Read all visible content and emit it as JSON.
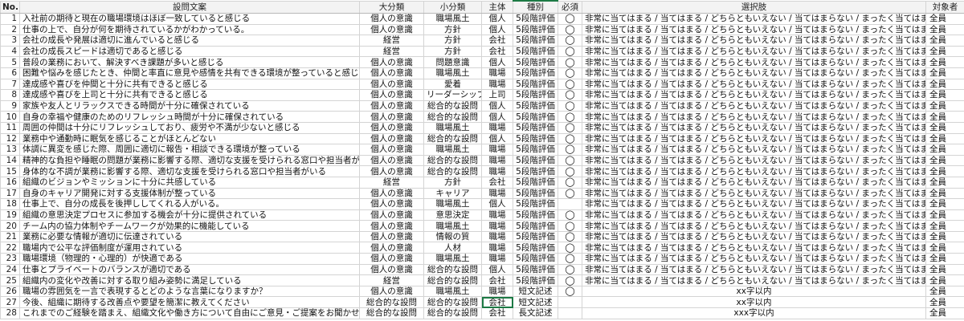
{
  "headers": {
    "no": "No.",
    "question": "設問文案",
    "major": "大分類",
    "minor": "小分類",
    "subject": "主体",
    "type": "種別",
    "required": "必須",
    "choices": "選択肢",
    "target": "対象者"
  },
  "rows": [
    {
      "no": "1",
      "question": "入社前の期待と現在の職場環境はほぼ一致していると感じる",
      "major": "個人の意識",
      "minor": "職場風土",
      "subject": "個人",
      "type": "5段階評価",
      "required": "◯",
      "choices": "非常に当てはまる / 当てはまる / どちらともいえない / 当てはまらない / まったく当てはまらない",
      "target": "全員"
    },
    {
      "no": "2",
      "question": "仕事の上で、自分が何を期待されているかがわかっている。",
      "major": "個人の意識",
      "minor": "方針",
      "subject": "個人",
      "type": "5段階評価",
      "required": "◯",
      "choices": "非常に当てはまる / 当てはまる / どちらともいえない / 当てはまらない / まったく当てはまらない",
      "target": "全員"
    },
    {
      "no": "3",
      "question": "会社の成長や発展は適切に進んでいると感じる",
      "major": "経営",
      "minor": "方針",
      "subject": "会社",
      "type": "5段階評価",
      "required": "◯",
      "choices": "非常に当てはまる / 当てはまる / どちらともいえない / 当てはまらない / まったく当てはまらない",
      "target": "全員"
    },
    {
      "no": "4",
      "question": "会社の成長スピードは適切であると感じる",
      "major": "経営",
      "minor": "方針",
      "subject": "会社",
      "type": "5段階評価",
      "required": "◯",
      "choices": "非常に当てはまる / 当てはまる / どちらともいえない / 当てはまらない / まったく当てはまらない",
      "target": "全員"
    },
    {
      "no": "5",
      "question": "普段の業務において、解決すべき課題が多いと感じる",
      "major": "個人の意識",
      "minor": "問題意識",
      "subject": "個人",
      "type": "5段階評価",
      "required": "◯",
      "choices": "非常に当てはまる / 当てはまる / どちらともいえない / 当てはまらない / まったく当てはまらない",
      "target": "全員"
    },
    {
      "no": "6",
      "question": "困難や悩みを感じたとき、仲間と率直に意見や感情を共有できる環境が整っていると感じる",
      "major": "個人の意識",
      "minor": "職場風土",
      "subject": "職場",
      "type": "5段階評価",
      "required": "◯",
      "choices": "非常に当てはまる / 当てはまる / どちらともいえない / 当てはまらない / まったく当てはまらない",
      "target": "全員"
    },
    {
      "no": "7",
      "question": "達成感や喜びを仲間と十分に共有できると感じる",
      "major": "個人の意識",
      "minor": "愛着",
      "subject": "職場",
      "type": "5段階評価",
      "required": "◯",
      "choices": "非常に当てはまる / 当てはまる / どちらともいえない / 当てはまらない / まったく当てはまらない",
      "target": "全員"
    },
    {
      "no": "8",
      "question": "達成感や喜びを上司と十分に共有できると感じる",
      "major": "個人の意識",
      "minor": "リーダーシップ",
      "subject": "上司",
      "type": "5段階評価",
      "required": "◯",
      "choices": "非常に当てはまる / 当てはまる / どちらともいえない / 当てはまらない / まったく当てはまらない",
      "target": "全員"
    },
    {
      "no": "9",
      "question": "家族や友人とリラックスできる時間が十分に確保されている",
      "major": "個人の意識",
      "minor": "総合的な設問",
      "subject": "個人",
      "type": "5段階評価",
      "required": "◯",
      "choices": "非常に当てはまる / 当てはまる / どちらともいえない / 当てはまらない / まったく当てはまらない",
      "target": "全員"
    },
    {
      "no": "10",
      "question": "自身の幸福や健康のためのリフレッシュ時間が十分に確保されている",
      "major": "個人の意識",
      "minor": "総合的な設問",
      "subject": "個人",
      "type": "5段階評価",
      "required": "◯",
      "choices": "非常に当てはまる / 当てはまる / どちらともいえない / 当てはまらない / まったく当てはまらない",
      "target": "全員"
    },
    {
      "no": "11",
      "question": "周囲の仲間は十分にリフレッシュしており、疲労や不満が少ないと感じる",
      "major": "個人の意識",
      "minor": "職場風土",
      "subject": "職場",
      "type": "5段階評価",
      "required": "◯",
      "choices": "非常に当てはまる / 当てはまる / どちらともいえない / 当てはまらない / まったく当てはまらない",
      "target": "全員"
    },
    {
      "no": "12",
      "question": "業務中や通勤時に眠気を感じることがほとんどない",
      "major": "個人の意識",
      "minor": "総合的な設問",
      "subject": "個人",
      "type": "5段階評価",
      "required": "◯",
      "choices": "非常に当てはまる / 当てはまる / どちらともいえない / 当てはまらない / まったく当てはまらない",
      "target": "全員"
    },
    {
      "no": "13",
      "question": "体調に異変を感じた際、周囲に適切に報告・相談できる環境が整っている",
      "major": "個人の意識",
      "minor": "職場風土",
      "subject": "職場",
      "type": "5段階評価",
      "required": "◯",
      "choices": "非常に当てはまる / 当てはまる / どちらともいえない / 当てはまらない / まったく当てはまらない",
      "target": "全員"
    },
    {
      "no": "14",
      "question": "精神的な負担や睡眠の問題が業務に影響する際、適切な支援を受けられる窓口や担当者がいる",
      "major": "個人の意識",
      "minor": "総合的な設問",
      "subject": "職場",
      "type": "5段階評価",
      "required": "◯",
      "choices": "非常に当てはまる / 当てはまる / どちらともいえない / 当てはまらない / まったく当てはまらない",
      "target": "全員"
    },
    {
      "no": "15",
      "question": "身体的な不調が業務に影響する際、適切な支援を受けられる窓口や担当者がいる",
      "major": "個人の意識",
      "minor": "総合的な設問",
      "subject": "職場",
      "type": "5段階評価",
      "required": "◯",
      "choices": "非常に当てはまる / 当てはまる / どちらともいえない / 当てはまらない / まったく当てはまらない",
      "target": "全員"
    },
    {
      "no": "16",
      "question": "組織のビジョンやミッションに十分に共感している",
      "major": "経営",
      "minor": "方針",
      "subject": "会社",
      "type": "5段階評価",
      "required": "◯",
      "choices": "非常に当てはまる / 当てはまる / どちらともいえない / 当てはまらない / まったく当てはまらない",
      "target": "全員"
    },
    {
      "no": "17",
      "question": "自身のキャリア開発に対する支援体制が整っている",
      "major": "個人の意識",
      "minor": "キャリア",
      "subject": "職場",
      "type": "5段階評価",
      "required": "◯",
      "choices": "非常に当てはまる / 当てはまる / どちらともいえない / 当てはまらない / まったく当てはまらない",
      "target": "全員"
    },
    {
      "no": "18",
      "question": "仕事上で、自分の成長を後押ししてくれる人がいる。",
      "major": "個人の意識",
      "minor": "職場風土",
      "subject": "個人",
      "type": "5段階評価",
      "required": "",
      "choices": "非常に当てはまる / 当てはまる / どちらともいえない / 当てはまらない / まったく当てはまらない",
      "target": "全員"
    },
    {
      "no": "19",
      "question": "組織の意思決定プロセスに参加する機会が十分に提供されている",
      "major": "個人の意識",
      "minor": "意思決定",
      "subject": "職場",
      "type": "5段階評価",
      "required": "◯",
      "choices": "非常に当てはまる / 当てはまる / どちらともいえない / 当てはまらない / まったく当てはまらない",
      "target": "全員"
    },
    {
      "no": "20",
      "question": "チーム内の協力体制やチームワークが効果的に機能している",
      "major": "個人の意識",
      "minor": "職場風土",
      "subject": "職場",
      "type": "5段階評価",
      "required": "◯",
      "choices": "非常に当てはまる / 当てはまる / どちらともいえない / 当てはまらない / まったく当てはまらない",
      "target": "全員"
    },
    {
      "no": "21",
      "question": "業務に必要な情報が適切に伝達されている",
      "major": "個人の意識",
      "minor": "情報の質",
      "subject": "職場",
      "type": "5段階評価",
      "required": "◯",
      "choices": "非常に当てはまる / 当てはまる / どちらともいえない / 当てはまらない / まったく当てはまらない",
      "target": "全員"
    },
    {
      "no": "22",
      "question": "職場内で公平な評価制度が運用されている",
      "major": "個人の意識",
      "minor": "人材",
      "subject": "職場",
      "type": "5段階評価",
      "required": "◯",
      "choices": "非常に当てはまる / 当てはまる / どちらともいえない / 当てはまらない / まったく当てはまらない",
      "target": "全員"
    },
    {
      "no": "23",
      "question": "職場環境（物理的・心理的）が快適である",
      "major": "個人の意識",
      "minor": "職場風土",
      "subject": "職場",
      "type": "5段階評価",
      "required": "◯",
      "choices": "非常に当てはまる / 当てはまる / どちらともいえない / 当てはまらない / まったく当てはまらない",
      "target": "全員"
    },
    {
      "no": "24",
      "question": "仕事とプライベートのバランスが適切である",
      "major": "個人の意識",
      "minor": "総合的な設問",
      "subject": "個人",
      "type": "5段階評価",
      "required": "◯",
      "choices": "非常に当てはまる / 当てはまる / どちらともいえない / 当てはまらない / まったく当てはまらない",
      "target": "全員"
    },
    {
      "no": "25",
      "question": "組織内の変化や改善に対する取り組み姿勢に満足している",
      "major": "経営",
      "minor": "総合的な設問",
      "subject": "会社",
      "type": "5段階評価",
      "required": "◯",
      "choices": "非常に当てはまる / 当てはまる / どちらともいえない / 当てはまらない / まったく当てはまらない",
      "target": "全員"
    },
    {
      "no": "26",
      "question": "職場の雰囲気を一言で表現するとどのような言葉になりますか？",
      "major": "個人の意識",
      "minor": "職場風土",
      "subject": "職場",
      "type": "短文記述",
      "required": "◯",
      "choices": "xx字以内",
      "target": "全員"
    },
    {
      "no": "27",
      "question": "今後、組織に期待する改善点や要望を簡潔に教えてください",
      "major": "総合的な設問",
      "minor": "総合的な設問",
      "subject": "会社",
      "type": "短文記述",
      "required": "",
      "choices": "xx字以内",
      "target": "全員"
    },
    {
      "no": "28",
      "question": "これまでのご経験を踏まえ、組織文化や働き方について自由にご意見・ご提案をお聞かせください",
      "major": "総合的な設問",
      "minor": "総合的な設問",
      "subject": "会社",
      "type": "長文記述",
      "required": "",
      "choices": "xxx字以内",
      "target": "全員"
    }
  ],
  "colors": {
    "selection_border": "#1d7a45",
    "header_bg": "#f3f3f3",
    "grid_line": "#d4d4d4"
  }
}
